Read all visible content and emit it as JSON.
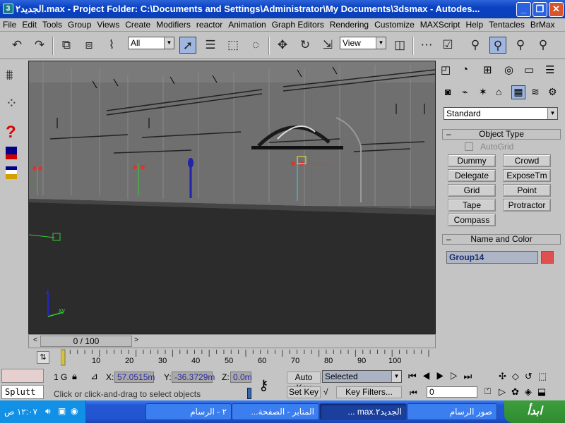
{
  "window": {
    "title": "الجديد٢.max   - Project Folder: C:\\Documents and Settings\\Administrator\\My Documents\\3dsmax   - Autodes..."
  },
  "menu": [
    "File",
    "Edit",
    "Tools",
    "Group",
    "Views",
    "Create",
    "Modifiers",
    "reactor",
    "Animation",
    "Graph Editors",
    "Rendering",
    "Customize",
    "MAXScript",
    "Help",
    "Tentacles",
    "BrMax"
  ],
  "toolbar": {
    "selection_filter": "All",
    "reference_coord": "View"
  },
  "time_slider": {
    "label": "0 / 100",
    "prev_arrow": "<",
    "next_arrow": ">",
    "current": 0,
    "end": 100
  },
  "trackbar": {
    "ticks": [
      "10",
      "20",
      "30",
      "40",
      "50",
      "60",
      "70",
      "80",
      "90",
      "100"
    ]
  },
  "command_panel": {
    "category": "Standard",
    "object_type_header": "Object Type",
    "autogrid_label": "AutoGrid",
    "buttons": [
      [
        "Dummy",
        "Crowd"
      ],
      [
        "Delegate",
        "ExposeTm"
      ],
      [
        "Grid",
        "Point"
      ],
      [
        "Tape",
        "Protractor"
      ],
      [
        "Compass",
        ""
      ]
    ],
    "name_color_header": "Name and Color",
    "object_name": "Group14",
    "object_color": "#e05050",
    "collapse_symbol": "–"
  },
  "status": {
    "script_listener": "Splutt",
    "selection_count": "1 G",
    "x_label": "X:",
    "x_value": "57.0515m",
    "y_label": "Y:",
    "y_value": "-36.3729m",
    "z_label": "Z:",
    "z_value": "0.0m",
    "prompt": "Click or click-and-drag to select objects",
    "auto_key": "Auto Key",
    "set_key": "Set Key",
    "key_mode": "Selected",
    "key_filters": "Key Filters...",
    "frame_value": "0"
  },
  "taskbar": {
    "clock": "١٢:٠٧ ص",
    "start_label": "ابدأ",
    "tasks": [
      "صور الرسام",
      "الجديد٢.max ...",
      "المنابر - الصفحة...",
      "٢ - الرسام"
    ]
  }
}
